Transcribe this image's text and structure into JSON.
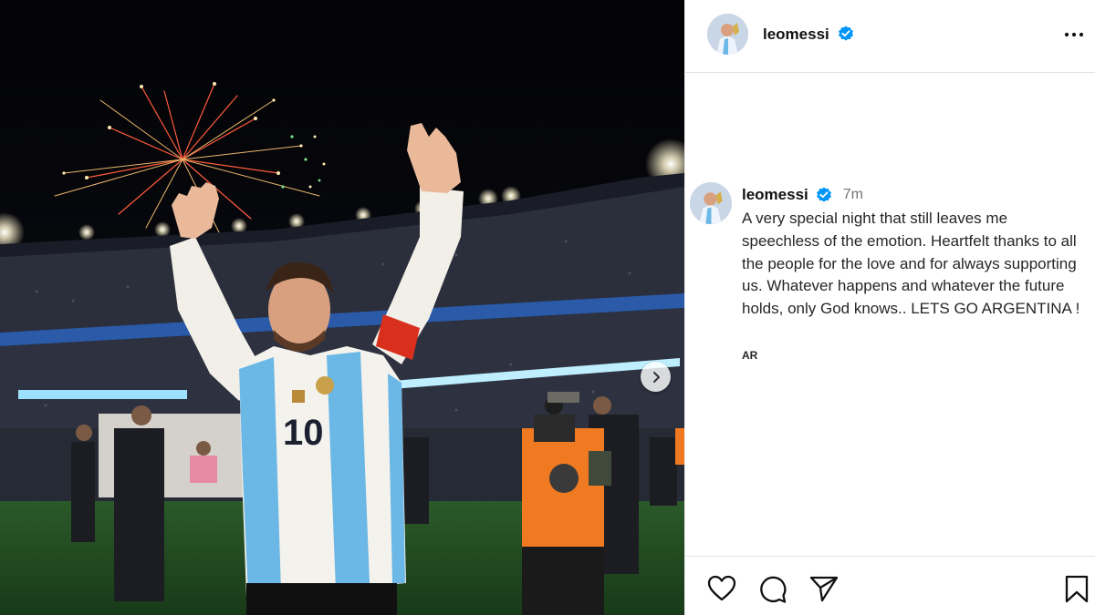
{
  "post": {
    "username": "leomessi",
    "verified": true,
    "more_icon": "more-options-icon"
  },
  "caption": {
    "username": "leomessi",
    "time_ago": "7m",
    "text": "A very special night that still leaves me speechless of the emotion. Heartfelt thanks to all the people for the love and for always supporting us. Whatever happens and whatever the future holds, only God knows.. LETS GO ARGENTINA !",
    "translate_label": "AR"
  },
  "photo": {
    "jersey_number": "10",
    "next_icon": "chevron-right-icon"
  },
  "actions": {
    "icons": [
      "heart-icon",
      "comment-icon",
      "share-icon",
      "bookmark-icon"
    ]
  },
  "colors": {
    "verified_blue": "#0095f6",
    "secondary_text": "#737373",
    "jersey_blue": "#6bb7e5"
  }
}
